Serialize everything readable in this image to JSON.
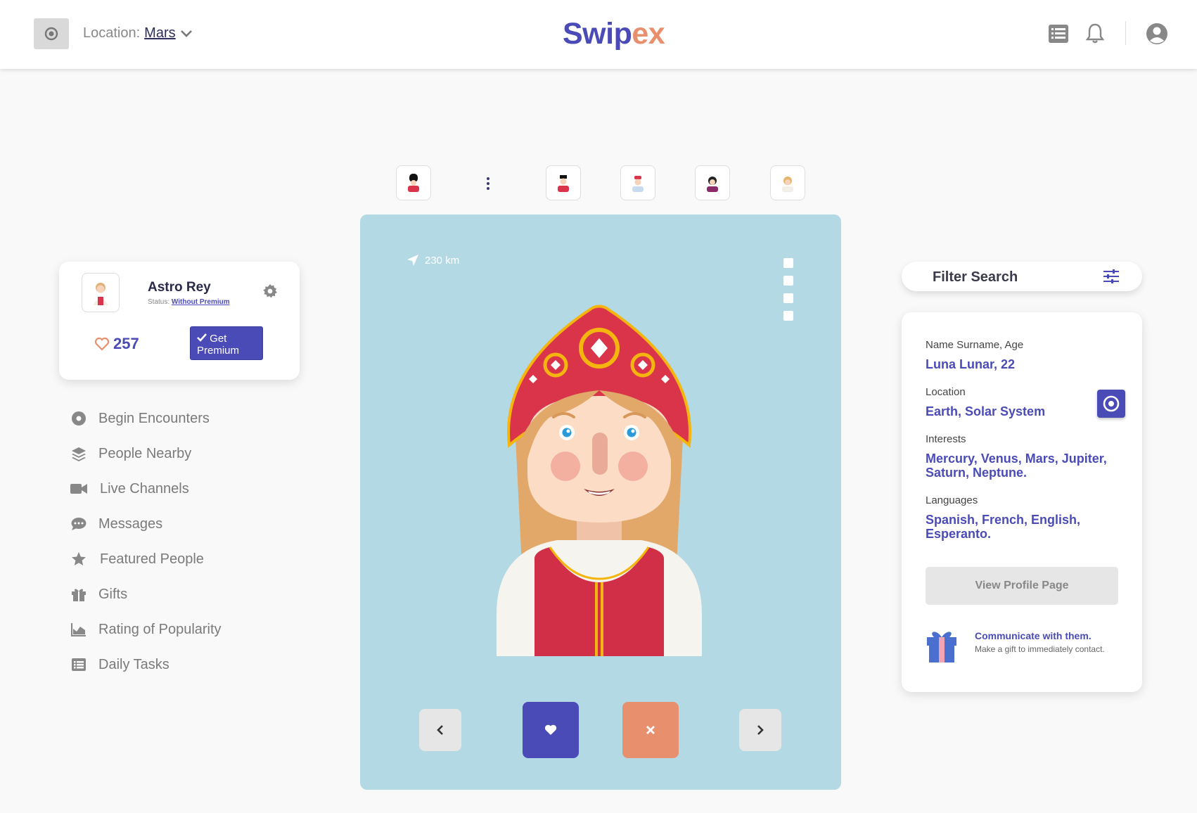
{
  "header": {
    "location_label": "Location:",
    "location_value": "Mars",
    "logo_part1": "Swip",
    "logo_part2": "ex"
  },
  "thumbnails": [
    {
      "icon": "avatar-guard"
    },
    {
      "icon": "more-dots"
    },
    {
      "icon": "avatar-king"
    },
    {
      "icon": "avatar-boy-red-hat"
    },
    {
      "icon": "avatar-girl-dark-hair"
    },
    {
      "icon": "avatar-blonde"
    }
  ],
  "user": {
    "name": "Astro Rey",
    "status_label": "Status:",
    "status_value": "Without Premium",
    "likes": "257",
    "premium_button": "Get Premium"
  },
  "sidebar": {
    "items": [
      {
        "label": "Begin Encounters",
        "icon": "circle-dot-icon"
      },
      {
        "label": "People Nearby",
        "icon": "layers-icon"
      },
      {
        "label": "Live Channels",
        "icon": "video-camera-icon"
      },
      {
        "label": "Messages",
        "icon": "chat-bubble-icon"
      },
      {
        "label": "Featured People",
        "icon": "star-icon"
      },
      {
        "label": "Gifts",
        "icon": "gift-icon"
      },
      {
        "label": "Rating of Popularity",
        "icon": "area-chart-icon"
      },
      {
        "label": "Daily Tasks",
        "icon": "list-icon"
      }
    ]
  },
  "profile_card": {
    "distance": "230 km",
    "bg_color": "#b3d9e5"
  },
  "filter": {
    "label": "Filter Search"
  },
  "details": {
    "name_label": "Name Surname, Age",
    "name_value": "Luna Lunar, 22",
    "location_label": "Location",
    "location_value": "Earth, Solar System",
    "interests_label": "Interests",
    "interests_value": "Mercury, Venus, Mars, Jupiter, Saturn, Neptune.",
    "languages_label": "Languages",
    "languages_value": "Spanish, French, English, Esperanto.",
    "view_button": "View Profile Page",
    "gift_title": "Communicate with them.",
    "gift_sub": "Make a gift to immediately contact."
  },
  "colors": {
    "accent": "#4b4bb8",
    "secondary": "#e88f6e",
    "card_bg": "#b3d9e5"
  }
}
